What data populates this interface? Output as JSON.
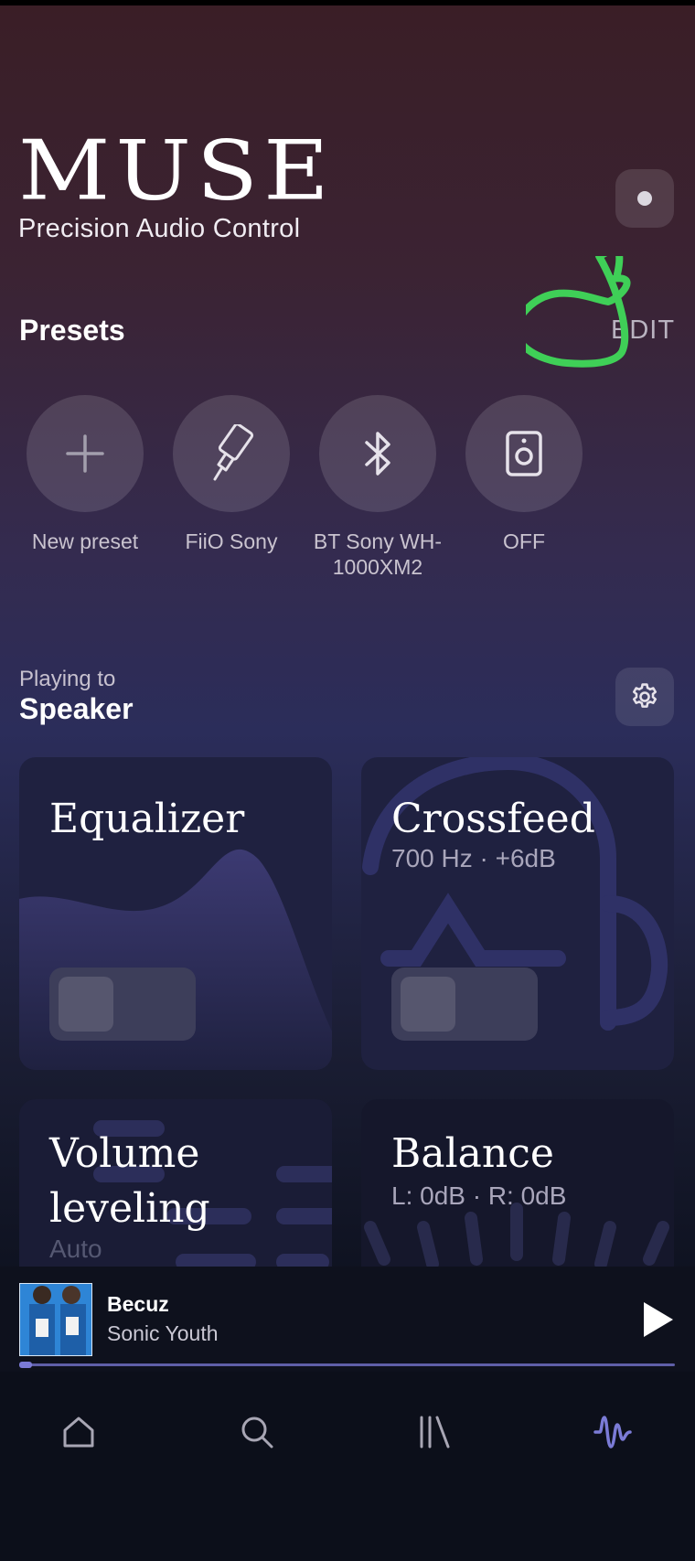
{
  "brand": {
    "title": "MUSE",
    "subtitle": "Precision Audio Control"
  },
  "presets": {
    "title": "Presets",
    "edit_label": "EDIT",
    "items": [
      {
        "label": "New preset",
        "icon": "plus-icon"
      },
      {
        "label": "FiiO Sony",
        "icon": "usb-cable-icon"
      },
      {
        "label": "BT Sony WH-1000XM2",
        "icon": "bluetooth-icon"
      },
      {
        "label": "OFF",
        "icon": "speaker-icon"
      }
    ]
  },
  "output": {
    "caption": "Playing to",
    "device": "Speaker"
  },
  "cards": {
    "equalizer": {
      "title": "Equalizer",
      "enabled": false
    },
    "crossfeed": {
      "title": "Crossfeed",
      "subtitle": "700 Hz · +6dB",
      "enabled": false
    },
    "volume_leveling": {
      "title": "Volume leveling",
      "subtitle": "Auto"
    },
    "balance": {
      "title": "Balance",
      "subtitle": "L: 0dB · R: 0dB"
    }
  },
  "now_playing": {
    "title": "Becuz",
    "artist": "Sonic Youth",
    "progress": 0.02
  },
  "nav": [
    "home-icon",
    "search-icon",
    "library-icon",
    "audio-wave-icon"
  ],
  "colors": {
    "accent": "#7b7bd6",
    "annotation": "#3fcf57",
    "card": "#1f2140"
  }
}
